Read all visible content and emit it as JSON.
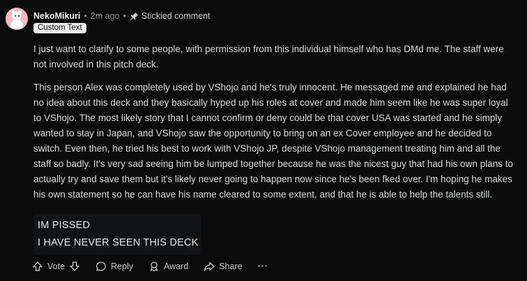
{
  "comment": {
    "username": "NekoMikuri",
    "time": "2m ago",
    "stickied": "Stickied comment",
    "flair": "Custom Text",
    "paragraphs": [
      "I just want to clarify to some people, with permission from this individual himself who has DMd me. The staff were not involved in this pitch deck.",
      "This person Alex was completely used by VShojo and he's truly innocent. He messaged me and explained he had no idea about this deck and they basically hyped up his roles at cover and made him seem like he was super loyal to VShojo. The most likely story that I cannot confirm or deny could be that cover USA was started and he simply wanted to stay in Japan, and VShojo saw the opportunity to bring on an ex Cover employee and he decided to switch. Even then, he tried his best to work with VShojo JP, despite VShojo management treating him and all the staff so badly. It's very sad seeing him be lumped together because he was the nicest guy that had his own plans to actually try and save them but it's likely never going to happen now since he's been fked over. I'm hoping he makes his own statement so he can have his name cleared to some extent, and that he is able to help the talents still."
    ],
    "image_text": [
      "IM PISSED",
      "I HAVE NEVER SEEN THIS DECK"
    ]
  },
  "actions": {
    "vote": "Vote",
    "reply": "Reply",
    "award": "Award",
    "share": "Share",
    "more": "···"
  },
  "icons": {
    "upvote": "arrow-up-icon",
    "downvote": "arrow-down-icon",
    "reply": "speech-bubble-icon",
    "award": "award-icon",
    "share": "share-arrow-icon",
    "pin": "pin-icon"
  },
  "colors": {
    "background": "#0b0b0b",
    "avatar": "#f3b8bf",
    "flair_bg": "#e8e8e8"
  }
}
